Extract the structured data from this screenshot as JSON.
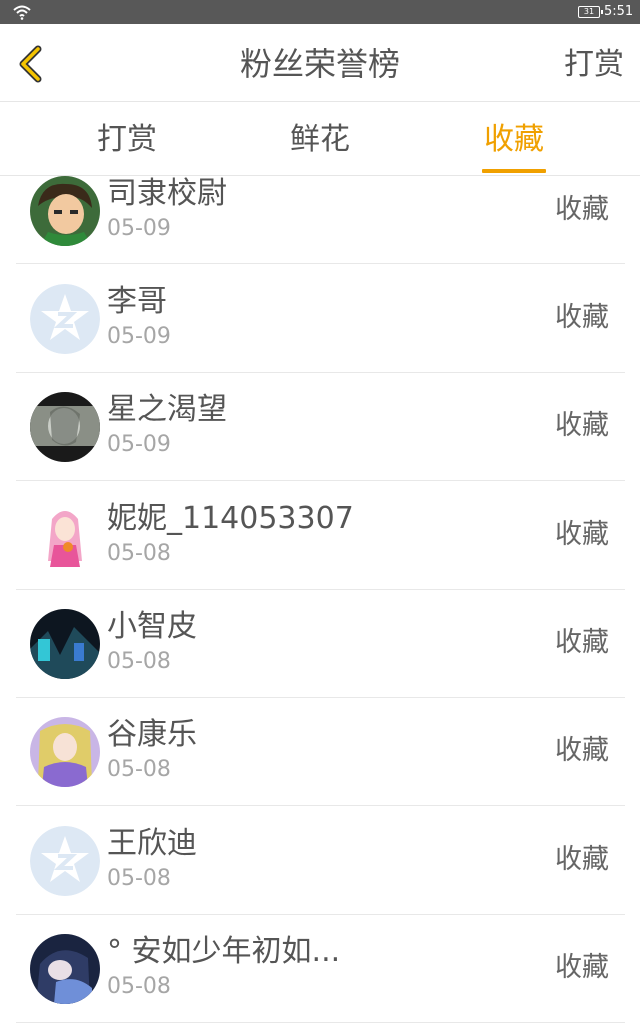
{
  "status_bar": {
    "time": "5:51",
    "battery_level": "31"
  },
  "nav": {
    "title": "粉丝荣誉榜",
    "action": "打赏"
  },
  "tabs": [
    {
      "label": "打赏",
      "active": false
    },
    {
      "label": "鲜花",
      "active": false
    },
    {
      "label": "收藏",
      "active": true
    }
  ],
  "colors": {
    "accent": "#f0a000",
    "text": "#555555",
    "muted": "#a6a6a6"
  },
  "fans": [
    {
      "name": "司隶校尉",
      "date": "05-09",
      "action": "收藏",
      "avatar": "cartoon-hero"
    },
    {
      "name": "李哥",
      "date": "05-09",
      "action": "收藏",
      "avatar": "default-star"
    },
    {
      "name": "星之渴望",
      "date": "05-09",
      "action": "收藏",
      "avatar": "gray-artwork"
    },
    {
      "name": "妮妮_114053307",
      "date": "05-08",
      "action": "收藏",
      "avatar": "anime-girl-pink"
    },
    {
      "name": "小智皮",
      "date": "05-08",
      "action": "收藏",
      "avatar": "dark-game-art"
    },
    {
      "name": "谷康乐",
      "date": "05-08",
      "action": "收藏",
      "avatar": "anime-purple"
    },
    {
      "name": "王欣迪",
      "date": "05-08",
      "action": "收藏",
      "avatar": "default-star"
    },
    {
      "name": "° 安如少年初如...",
      "date": "05-08",
      "action": "收藏",
      "avatar": "blue-portrait"
    }
  ]
}
